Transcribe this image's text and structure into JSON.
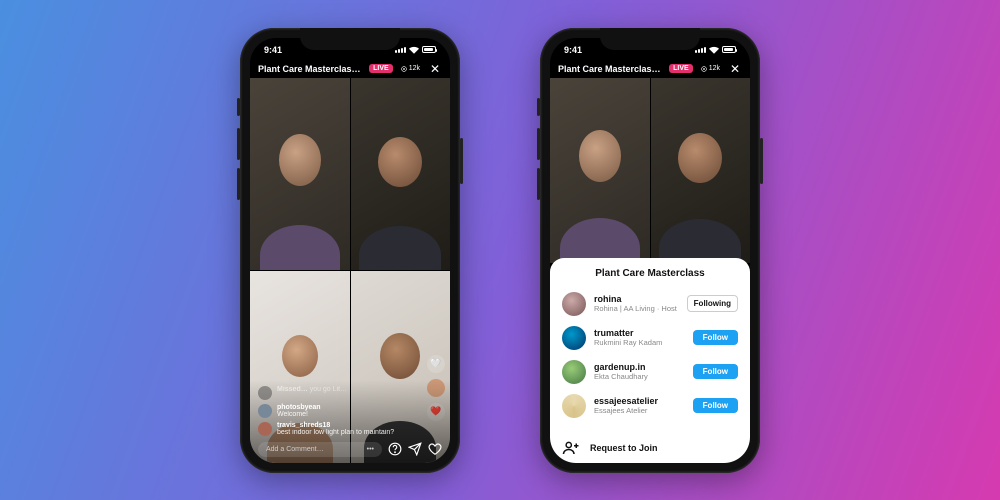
{
  "status": {
    "time": "9:41"
  },
  "live": {
    "title": "Plant Care Masterclass…",
    "badge": "LIVE",
    "viewers": "12k"
  },
  "comments": [
    {
      "user": "Missed…",
      "text": "you go Lit…"
    },
    {
      "user": "photosbyean",
      "text": "Welcome!"
    },
    {
      "user": "travis_shreds18",
      "text": "best indoor low light plan to maintain?"
    }
  ],
  "input": {
    "placeholder": "Add a Comment…",
    "more": "•••"
  },
  "sheet": {
    "title": "Plant Care Masterclass",
    "participants": [
      {
        "user": "rohina",
        "sub": "Rohina | AA Living · Host",
        "action": "Following"
      },
      {
        "user": "trumatter",
        "sub": "Rukmini Ray Kadam",
        "action": "Follow"
      },
      {
        "user": "gardenup.in",
        "sub": "Ekta Chaudhary",
        "action": "Follow"
      },
      {
        "user": "essajeesatelier",
        "sub": "Essajees Atelier",
        "action": "Follow"
      }
    ],
    "request": "Request to Join"
  }
}
